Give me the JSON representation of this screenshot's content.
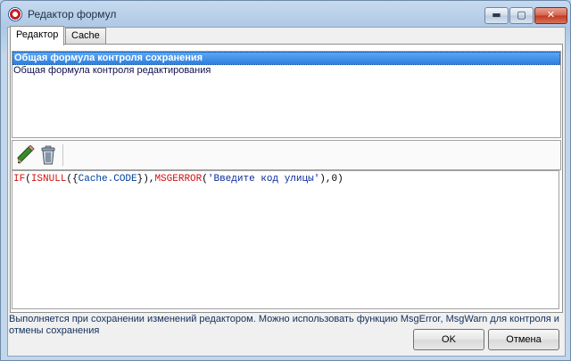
{
  "window": {
    "title": "Редактор формул",
    "controls": {
      "minimize": "▬",
      "maximize": "▢",
      "close": "✕"
    }
  },
  "tabs": [
    {
      "label": "Редактор",
      "active": true
    },
    {
      "label": "Cache",
      "active": false
    }
  ],
  "formula_list": [
    {
      "label": "Общая формула контроля сохранения",
      "selected": true
    },
    {
      "label": "Общая формула контроля редактирования",
      "selected": false
    }
  ],
  "toolbar": {
    "icons": [
      "pencil-icon",
      "trash-icon"
    ]
  },
  "editor": {
    "tokens": [
      {
        "text": "IF",
        "kind": "fn"
      },
      {
        "text": "(",
        "kind": "pn"
      },
      {
        "text": "ISNULL",
        "kind": "fn"
      },
      {
        "text": "({",
        "kind": "pn"
      },
      {
        "text": "Cache.CODE",
        "kind": "fld"
      },
      {
        "text": "}),",
        "kind": "pn"
      },
      {
        "text": "MSGERROR",
        "kind": "fn"
      },
      {
        "text": "(",
        "kind": "pn"
      },
      {
        "text": "'Введите код улицы'",
        "kind": "str"
      },
      {
        "text": "),0)",
        "kind": "num"
      }
    ],
    "colors": {
      "function": "#d01010",
      "field": "#0040a0",
      "string": "#0a2a9a"
    }
  },
  "description": "Выполняется при сохранении изменений редактором. Можно использовать функцию MsgError, MsgWarn для контроля и отмены сохранения",
  "buttons": {
    "ok": "OK",
    "cancel": "Отмена"
  }
}
